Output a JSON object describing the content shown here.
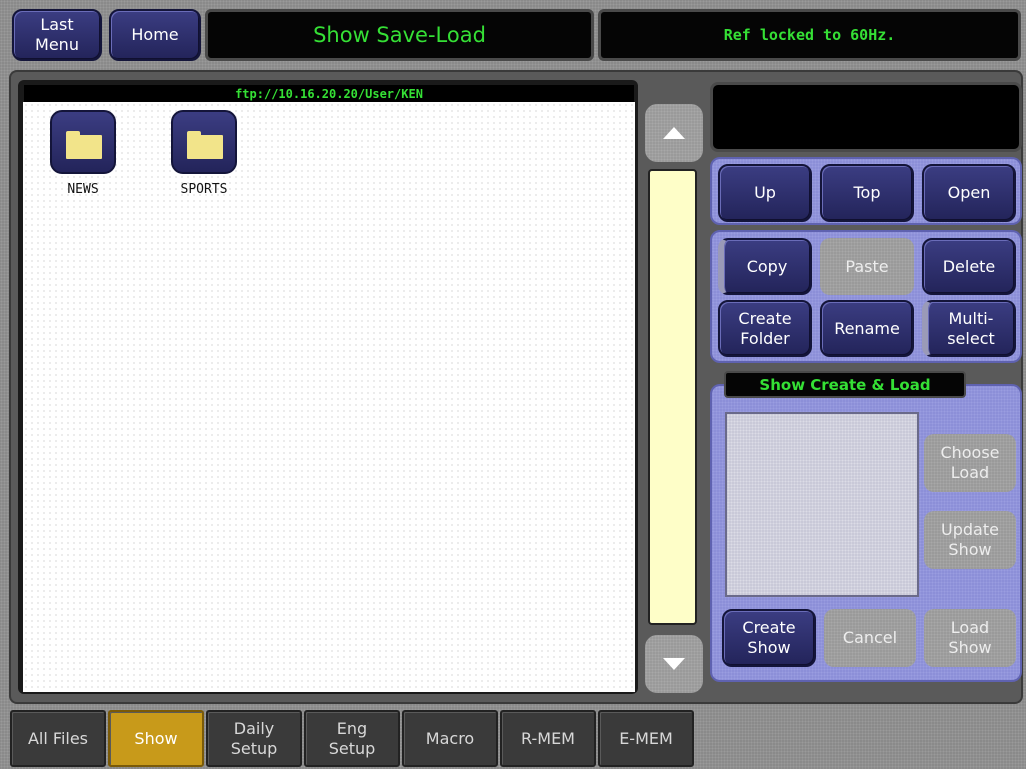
{
  "header": {
    "last_menu": "Last\nMenu",
    "home": "Home",
    "title": "Show Save-Load",
    "status": "Ref locked to 60Hz."
  },
  "browser": {
    "path": "ftp://10.16.20.20/User/KEN",
    "folders": [
      {
        "name": "NEWS",
        "icon": "folder-icon"
      },
      {
        "name": "SPORTS",
        "icon": "folder-icon"
      }
    ]
  },
  "scroll": {
    "up_icon": "arrow-up-icon",
    "down_icon": "arrow-down-icon"
  },
  "nav_buttons": {
    "up": "Up",
    "top": "Top",
    "open": "Open"
  },
  "edit_buttons": {
    "copy": "Copy",
    "paste": "Paste",
    "delete": "Delete",
    "create_folder": "Create\nFolder",
    "rename": "Rename",
    "multi_select": "Multi-\nselect"
  },
  "show_panel": {
    "title": "Show Create & Load",
    "choose_load": "Choose\nLoad",
    "update_show": "Update\nShow",
    "create_show": "Create\nShow",
    "cancel": "Cancel",
    "load_show": "Load\nShow"
  },
  "tabs": [
    {
      "label": "All Files",
      "active": false
    },
    {
      "label": "Show",
      "active": true
    },
    {
      "label": "Daily\nSetup",
      "active": false
    },
    {
      "label": "Eng\nSetup",
      "active": false
    },
    {
      "label": "Macro",
      "active": false
    },
    {
      "label": "R-MEM",
      "active": false
    },
    {
      "label": "E-MEM",
      "active": false
    }
  ],
  "colors": {
    "title_green": "#35e035",
    "active_tab": "#c89a1a",
    "panel_lavender": "#8c8fd8",
    "scroll_track": "#fefec8"
  }
}
